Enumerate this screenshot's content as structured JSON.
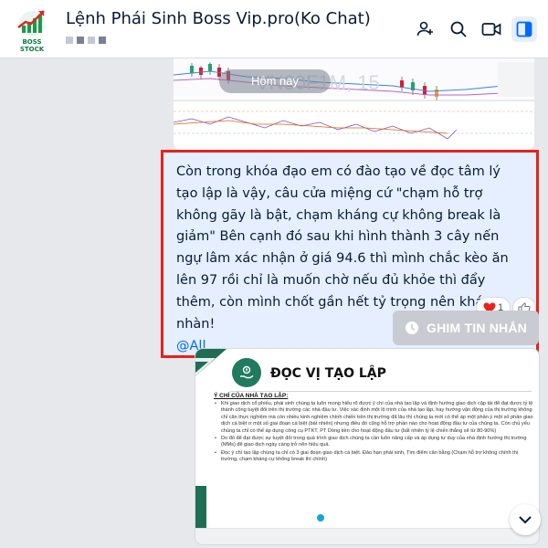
{
  "header": {
    "logo_text": "BOSS STOCK",
    "title": "Lệnh Phái Sinh Boss Vip.pro(Ko Chat)"
  },
  "chat": {
    "date_separator": "Hôm nay",
    "message": {
      "text": "Còn trong khóa đạo em có đào tạo về đọc tâm lý tạo lập là vậy, câu cửa miệng cứ \"chạm hỗ trợ không gãy là bật, chạm kháng cự không break là giảm\" Bên cạnh đó sau khi hình thành 3 cây nến ngự lâm xác nhận ở giá 94.6 thì mình chắc kèo ăn lên 97 rồi chỉ là muốn chờ nếu đủ khỏe thì đẩy thêm, còn mình chốt gần hết tỷ trọng nên khá nhàn!",
      "mention": "@All",
      "reaction_count": "1"
    },
    "pin_button_label": "GHIM TIN NHẮN",
    "document": {
      "title": "ĐỌC VỊ TẠO LẬP",
      "heading": "Ý CHÍ CỦA NHÀ TẠO LẬP:",
      "bullets": [
        "Khi giao dịch cổ phiếu, phái sinh chúng ta luôn mong hiểu rõ được ý chí của nhà tạo lập và định hướng giao dịch cặp tài để đạt được tỷ lệ thành công tuyệt đối trên thị trường các nhà đầu tư. Việc xác định một lộ trình của nhà tạo lập, hay hướng vận động của thị trường không chỉ căn thực nghiệm mà còn nhiều kinh nghiệm chính chiến trên thị trường đã lâu thì chúng ta mới có thể áp một phần ý một số phần giao dịch cá biệt ơ một số giai đoạn cá biệt (bất nhiên) nhưng điều đó cũng hỗ trợ phần nào cho hoạt động đầu tư của chúng ta. Còn chủ yếu chúng ta chỉ có thể áp dụng công cụ PTKT, PT Dòng tiền cho hoạt động đầu tư (bất nhiên tỷ lệ chiến thắng sẽ từ 80-90%)",
        "Do đó để đạt được sự tuyệt đối trong quá trình giao dịch chúng ta cần luôn nâng cấp và áp dụng tư duy của nhà định hướng thị trường (MMs) để giao dịch ngày càng trở nên hiệu quả.",
        "Đọc ý chí tạo lập chúng ta chỉ có 3 giai đoạn giao dịch cá biệt. Đảo hạn phái sinh, Tìm điểm cân bằng (Chạm hỗ trợ không chính thị trường, chạm kháng cự không break thì chính)"
      ]
    }
  }
}
